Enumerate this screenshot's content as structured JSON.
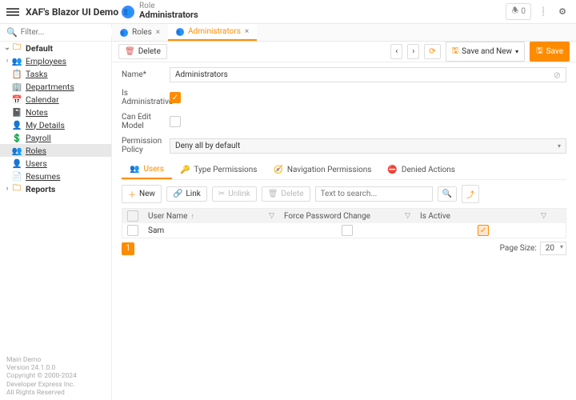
{
  "app_title": "XAF's Blazor UI Demo",
  "header": {
    "type": "Role",
    "title": "Administrators",
    "notif_count": "0"
  },
  "search_placeholder": "Filter...",
  "tree": {
    "root": "Default",
    "items": [
      {
        "label": "Employees",
        "icon": "👥"
      },
      {
        "label": "Tasks",
        "icon": "📋"
      },
      {
        "label": "Departments",
        "icon": "🏢",
        "color": "#3b8bff"
      },
      {
        "label": "Calendar",
        "icon": "📅",
        "color": "#d9534f"
      },
      {
        "label": "Notes",
        "icon": "📓",
        "color": "#6f42c1"
      },
      {
        "label": "My Details",
        "icon": "👤"
      },
      {
        "label": "Payroll",
        "icon": "💲",
        "color": "#28a745"
      },
      {
        "label": "Roles",
        "icon": "👥",
        "color": "#3b8bff",
        "selected": true
      },
      {
        "label": "Users",
        "icon": "👤"
      },
      {
        "label": "Resumes",
        "icon": "📄"
      }
    ],
    "section2": "Reports"
  },
  "tabs": [
    {
      "label": "Roles"
    },
    {
      "label": "Administrators",
      "active": true
    }
  ],
  "toolbar": {
    "delete": "Delete",
    "save_new": "Save and New",
    "save": "Save"
  },
  "form": {
    "name_label": "Name*",
    "name_value": "Administrators",
    "is_admin_label": "Is Administrative",
    "can_edit_label": "Can Edit Model",
    "policy_label": "Permission Policy",
    "policy_value": "Deny all by default"
  },
  "subtabs": [
    "Users",
    "Type Permissions",
    "Navigation Permissions",
    "Denied Actions"
  ],
  "subtoolbar": {
    "new": "New",
    "link": "Link",
    "unlink": "Unlink",
    "delete": "Delete",
    "search": "Text to search..."
  },
  "grid": {
    "cols": [
      "User Name",
      "Force Password Change",
      "Is Active"
    ],
    "row": {
      "user": "Sam",
      "force": false,
      "active": true
    },
    "page": "1",
    "page_size_label": "Page Size:",
    "page_size": "20"
  },
  "footer": {
    "l1": "Main Demo",
    "l2": "Version 24.1.0.0",
    "l3": "Copyright © 2000-2024 Developer Express Inc.",
    "l4": "All Rights Reserved"
  }
}
